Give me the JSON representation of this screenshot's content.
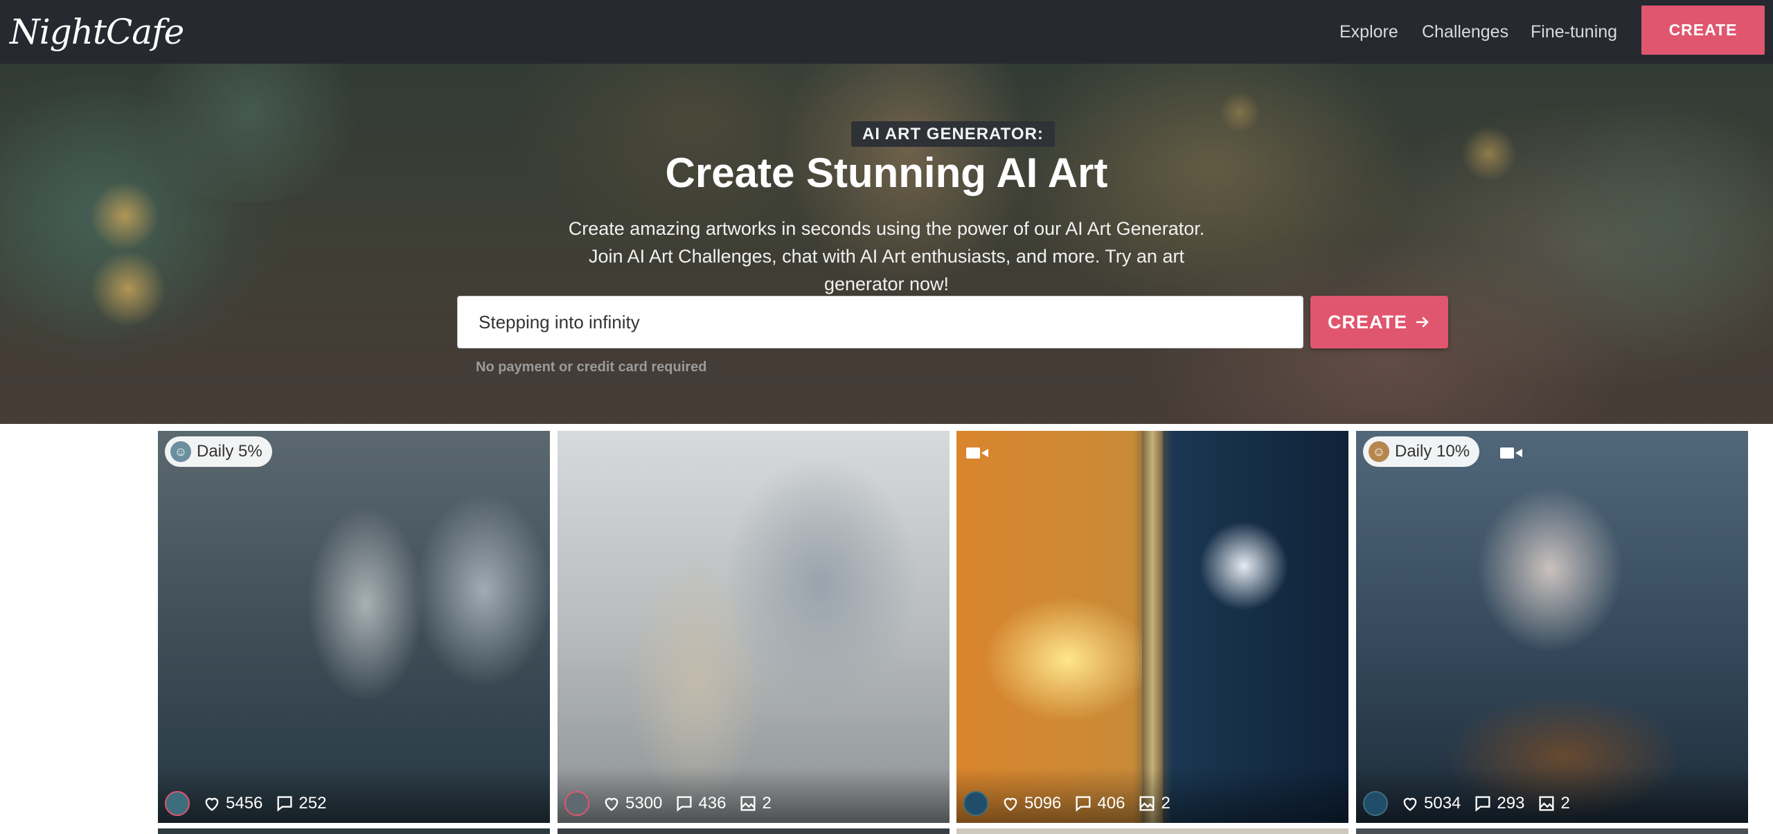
{
  "nav": {
    "logo": "NightCafe",
    "links": [
      "Explore",
      "Challenges",
      "Fine-tuning"
    ],
    "create_label": "CREATE"
  },
  "hero": {
    "badge": "AI ART GENERATOR:",
    "title": "Create Stunning AI Art",
    "subtitle": "Create amazing artworks in seconds using the power of our AI Art Generator. Join AI Art Challenges, chat with AI Art enthusiasts, and more. Try an art generator now!",
    "prompt_value": "Stepping into infinity",
    "create_label": "CREATE",
    "note": "No payment or credit card required"
  },
  "gallery": [
    {
      "tag": "Daily 5%",
      "video": false,
      "likes": "5456",
      "comments": "252",
      "images": null
    },
    {
      "tag": null,
      "video": false,
      "likes": "5300",
      "comments": "436",
      "images": "2"
    },
    {
      "tag": null,
      "video": true,
      "likes": "5096",
      "comments": "406",
      "images": "2"
    },
    {
      "tag": "Daily 10%",
      "video": true,
      "likes": "5034",
      "comments": "293",
      "images": "2"
    }
  ],
  "colors": {
    "accent": "#e0566e",
    "nav_bg": "#262a30"
  },
  "icons": [
    "heart-icon",
    "comment-icon",
    "images-icon",
    "video-icon",
    "arrow-right-icon"
  ]
}
